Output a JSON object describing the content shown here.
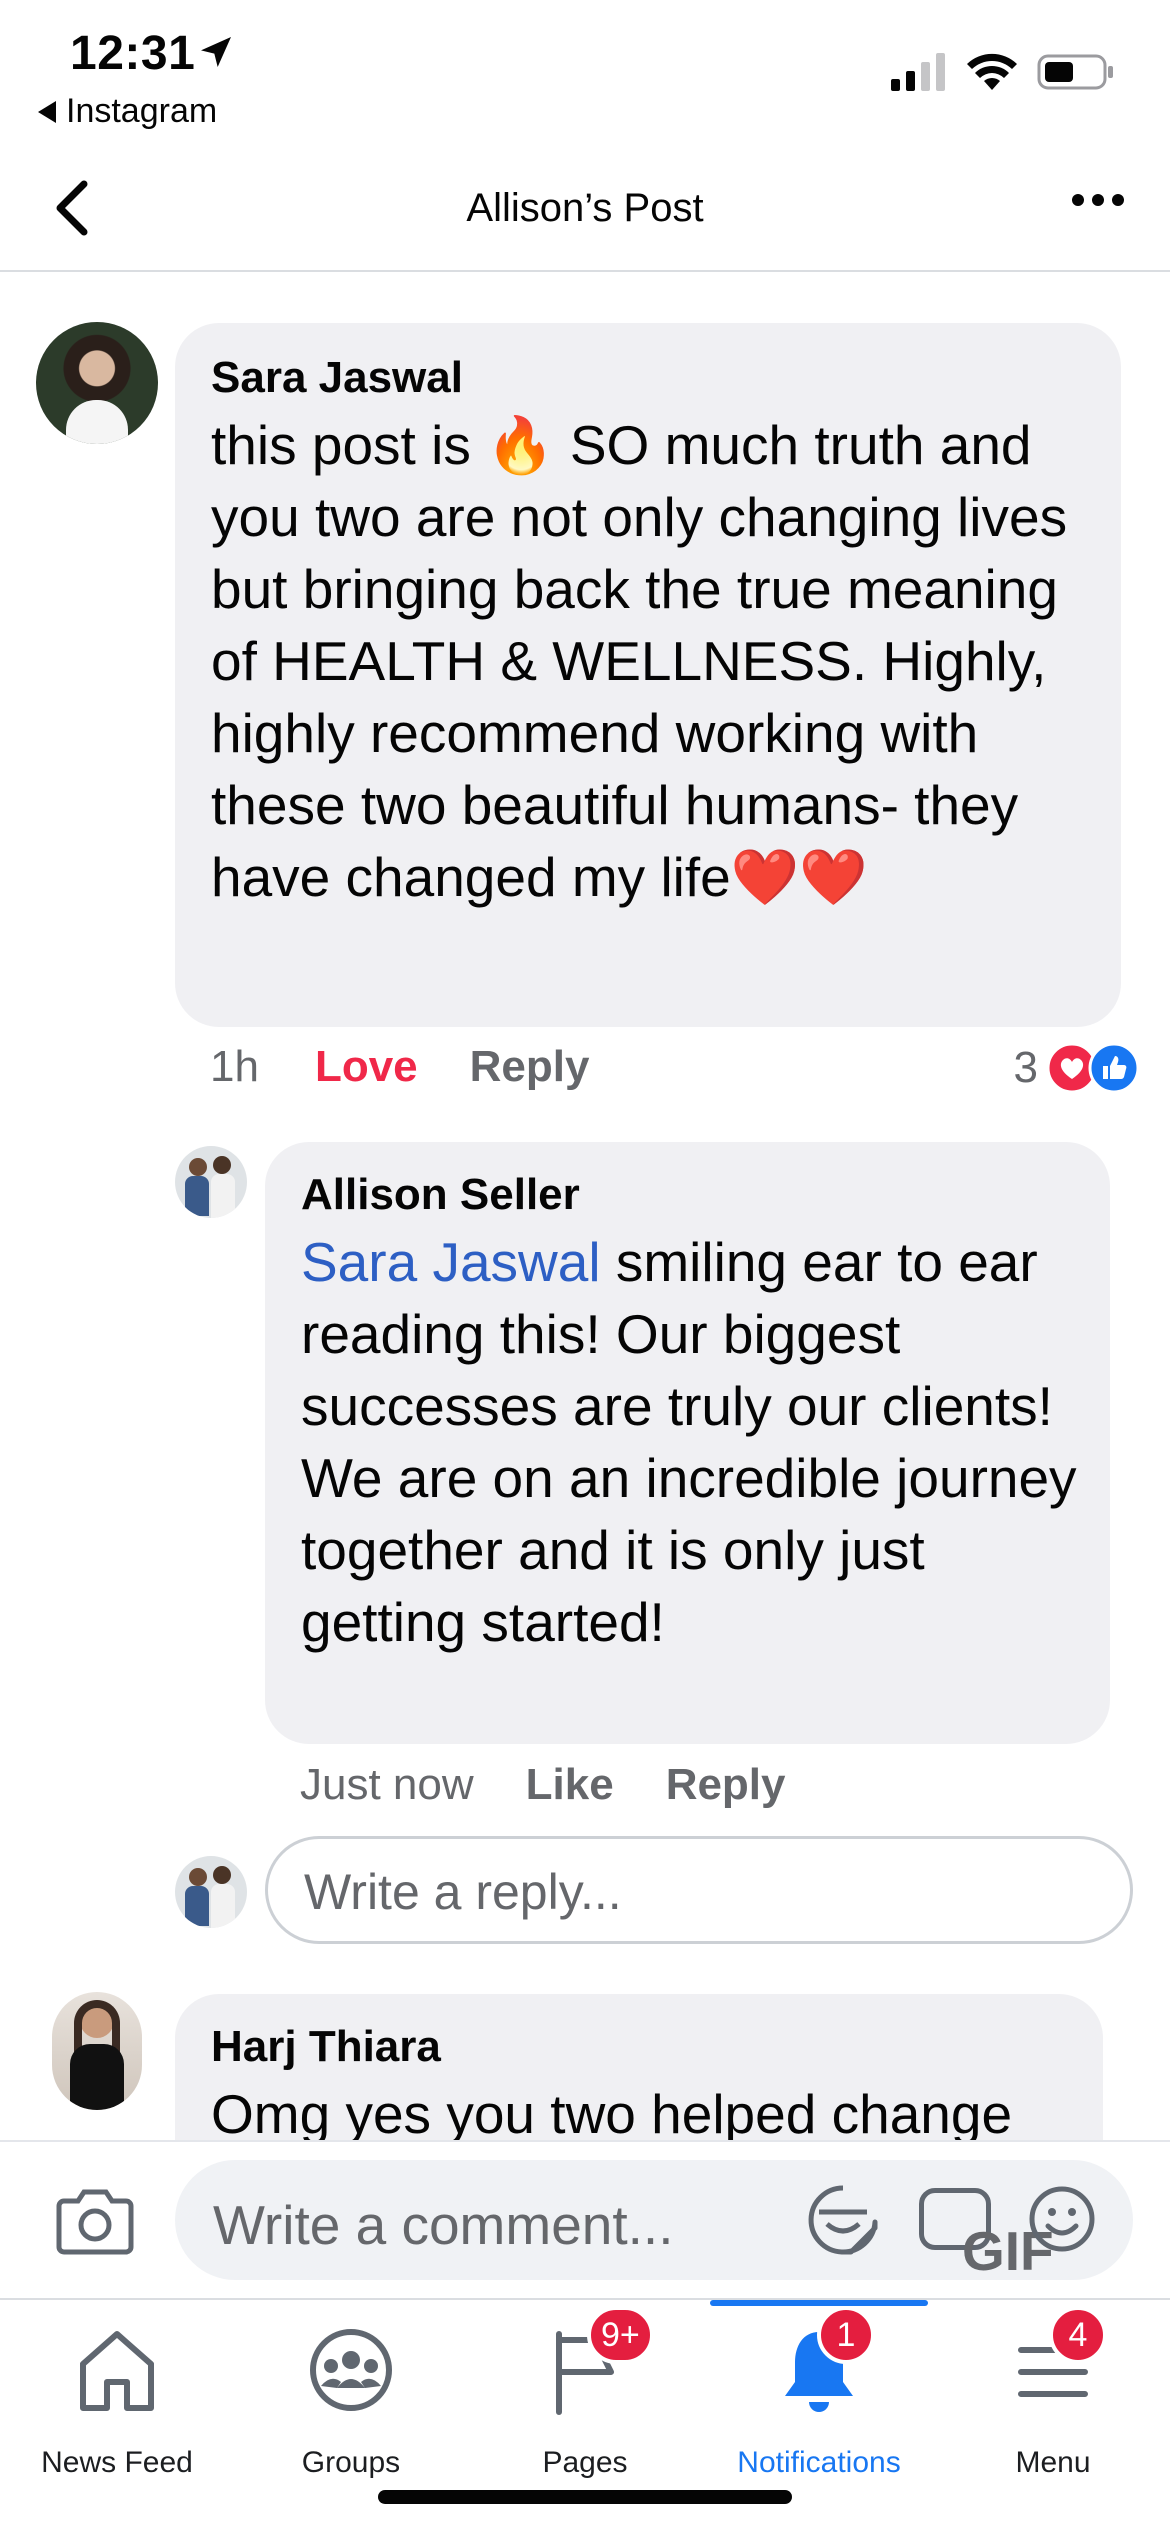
{
  "status_bar": {
    "time": "12:31",
    "back_app": "Instagram"
  },
  "header": {
    "title": "Allison’s Post"
  },
  "comments": [
    {
      "author": "Sara Jaswal",
      "text_before_fire": "this post is ",
      "fire_emoji": "🔥",
      "text_after_fire": " SO much truth and you two are not only changing lives but bringing back the true meaning of HEALTH & WELLNESS. Highly, highly recommend working with these two beautiful humans- they have changed my life",
      "hearts": "❤️❤️",
      "time": "1h",
      "reaction_action": "Love",
      "reply_action": "Reply",
      "reaction_count": "3",
      "colors": {
        "love": "#f02849",
        "like": "#1877f2"
      }
    },
    {
      "author": "Allison Seller",
      "mention": "Sara Jaswal",
      "text": " smiling ear to ear reading this!  Our biggest successes are truly our clients! We are on an incredible journey together and it is only just getting started!",
      "time": "Just now",
      "like_action": "Like",
      "reply_action": "Reply"
    },
    {
      "author": "Harj Thiara",
      "text": "Omg yes you two helped change"
    }
  ],
  "reply_box": {
    "placeholder": "Write a reply..."
  },
  "comment_bar": {
    "placeholder": "Write a comment...",
    "gif_label": "GIF"
  },
  "tab_bar": {
    "tabs": [
      {
        "label": "News Feed",
        "icon": "home-icon"
      },
      {
        "label": "Groups",
        "icon": "groups-icon"
      },
      {
        "label": "Pages",
        "icon": "flag-icon",
        "badge": "9+"
      },
      {
        "label": "Notifications",
        "icon": "bell-icon",
        "badge": "1",
        "active": true
      },
      {
        "label": "Menu",
        "icon": "menu-icon",
        "badge": "4"
      }
    ],
    "active_color": "#1877f2",
    "badge_color": "#e41e3f"
  }
}
